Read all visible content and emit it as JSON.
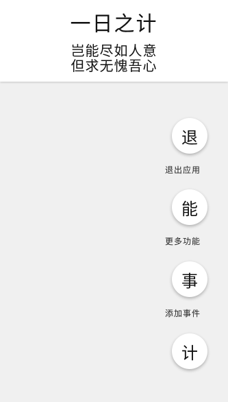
{
  "header": {
    "title": "一日之计",
    "subtitle_line1": "岂能尽如人意",
    "subtitle_line2": "但求无愧吾心"
  },
  "actions": [
    {
      "glyph": "退",
      "label": "退出应用"
    },
    {
      "glyph": "能",
      "label": "更多功能"
    },
    {
      "glyph": "事",
      "label": "添加事件"
    },
    {
      "glyph": "计",
      "label": ""
    }
  ]
}
